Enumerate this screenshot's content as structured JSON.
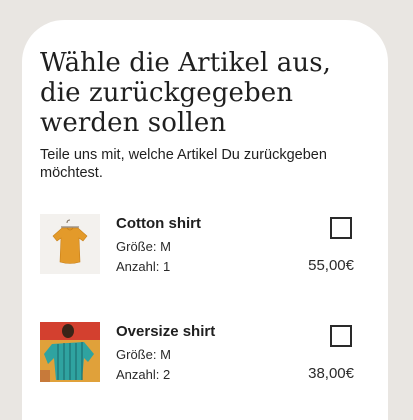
{
  "screen": {
    "title": "Wähle die Artikel aus, die zurückgegeben werden sollen",
    "subtitle": "Teile uns mit, welche Artikel Du zurückgeben möchtest."
  },
  "items": [
    {
      "name": "Cotton shirt",
      "size": "Größe: M",
      "quantity": "Anzahl: 1",
      "price": "55,00€",
      "image": "orange-shirt-on-hanger",
      "checked": false
    },
    {
      "name": "Oversize shirt",
      "size": "Größe: M",
      "quantity": "Anzahl: 2",
      "price": "38,00€",
      "image": "teal-striped-shirt-model",
      "checked": false
    }
  ],
  "colors": {
    "background": "#e9e6e2",
    "card": "#ffffff",
    "text": "#1f1f1f"
  }
}
